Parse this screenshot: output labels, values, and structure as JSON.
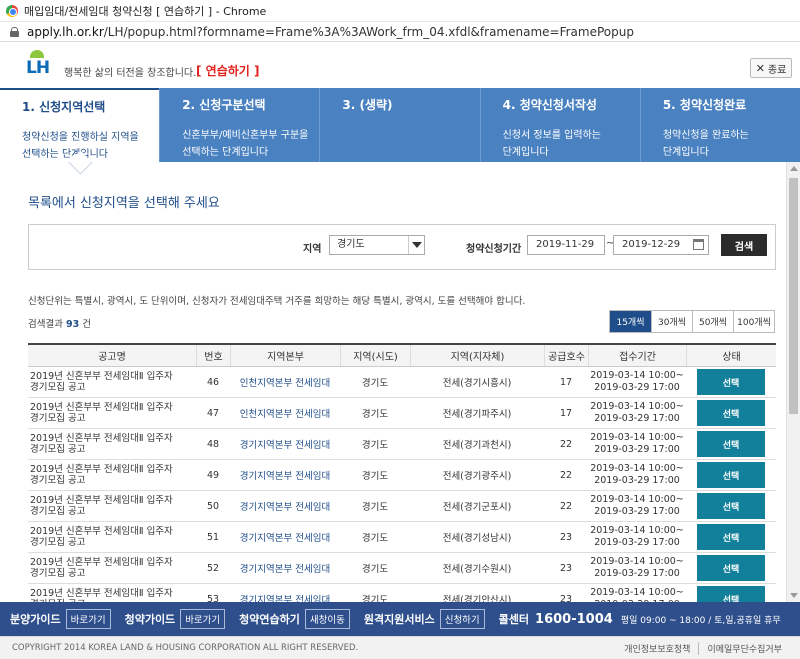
{
  "browser": {
    "title": "매입임대/전세임대 청약신청 [ 연습하기 ] - Chrome",
    "url_host": "apply.lh.or.kr",
    "url_path": "/LH/popup.html?formname=Frame%3A%3AWork_frm_04.xfdl&framename=FramePopup"
  },
  "header": {
    "logo": "LH",
    "slogan": "행복한 삶의 터전을 창조합니다.",
    "practice_tag": "[ 연습하기 ]",
    "close_label": "종료"
  },
  "steps": [
    {
      "title": "1. 신청지역선택",
      "desc1": "청약신청을 진행하실 지역을",
      "desc2": "선택하는 단계입니다"
    },
    {
      "title": "2. 신청구분선택",
      "desc1": "신혼부부/예비신혼부부 구분을",
      "desc2": "선택하는 단계입니다"
    },
    {
      "title": "3. (생략)",
      "desc1": "",
      "desc2": ""
    },
    {
      "title": "4. 청약신청서작성",
      "desc1": "신청서 정보를 입력하는",
      "desc2": "단계입니다"
    },
    {
      "title": "5. 청약신청완료",
      "desc1": "청약신청을 완료하는",
      "desc2": "단계입니다"
    }
  ],
  "main": {
    "title": "목록에서 신청지역을 선택해 주세요",
    "search": {
      "region_label": "지역",
      "region_value": "경기도",
      "period_label": "청약신청기간",
      "date_from": "2019-11-29",
      "tilde": "~",
      "date_to": "2019-12-29",
      "search_label": "검색"
    },
    "notice": "신청단위는 특별시, 광역시, 도 단위이며, 신청자가 전세임대주택 거주를 희망하는 해당 특별시, 광역시, 도를 선택해야 합니다.",
    "result_prefix": "검색결과",
    "result_count": "93",
    "result_suffix": "건",
    "page_sizes": [
      "15개씩",
      "30개씩",
      "50개씩",
      "100개씩"
    ]
  },
  "table": {
    "headers": [
      "공고명",
      "번호",
      "지역본부",
      "지역(시도)",
      "지역(지자체)",
      "공급호수",
      "접수기간",
      "상태"
    ],
    "button_label": "선택",
    "rows": [
      {
        "name1": "2019년 신혼부부 전세임대Ⅱ 입주자",
        "name2": "경기모집 공고",
        "no": "46",
        "hq": "인천지역본부 전세임대",
        "sido": "경기도",
        "local": "전세(경기시흥시)",
        "supply": "17",
        "from": "2019-03-14 10:00~",
        "to": "2019-03-29 17:00"
      },
      {
        "name1": "2019년 신혼부부 전세임대Ⅱ 입주자",
        "name2": "경기모집 공고",
        "no": "47",
        "hq": "인천지역본부 전세임대",
        "sido": "경기도",
        "local": "전세(경기파주시)",
        "supply": "17",
        "from": "2019-03-14 10:00~",
        "to": "2019-03-29 17:00"
      },
      {
        "name1": "2019년 신혼부부 전세임대Ⅱ 입주자",
        "name2": "경기모집 공고",
        "no": "48",
        "hq": "경기지역본부 전세임대",
        "sido": "경기도",
        "local": "전세(경기과천시)",
        "supply": "22",
        "from": "2019-03-14 10:00~",
        "to": "2019-03-29 17:00"
      },
      {
        "name1": "2019년 신혼부부 전세임대Ⅱ 입주자",
        "name2": "경기모집 공고",
        "no": "49",
        "hq": "경기지역본부 전세임대",
        "sido": "경기도",
        "local": "전세(경기광주시)",
        "supply": "22",
        "from": "2019-03-14 10:00~",
        "to": "2019-03-29 17:00"
      },
      {
        "name1": "2019년 신혼부부 전세임대Ⅱ 입주자",
        "name2": "경기모집 공고",
        "no": "50",
        "hq": "경기지역본부 전세임대",
        "sido": "경기도",
        "local": "전세(경기군포시)",
        "supply": "22",
        "from": "2019-03-14 10:00~",
        "to": "2019-03-29 17:00"
      },
      {
        "name1": "2019년 신혼부부 전세임대Ⅱ 입주자",
        "name2": "경기모집 공고",
        "no": "51",
        "hq": "경기지역본부 전세임대",
        "sido": "경기도",
        "local": "전세(경기성남시)",
        "supply": "23",
        "from": "2019-03-14 10:00~",
        "to": "2019-03-29 17:00"
      },
      {
        "name1": "2019년 신혼부부 전세임대Ⅱ 입주자",
        "name2": "경기모집 공고",
        "no": "52",
        "hq": "경기지역본부 전세임대",
        "sido": "경기도",
        "local": "전세(경기수원시)",
        "supply": "23",
        "from": "2019-03-14 10:00~",
        "to": "2019-03-29 17:00"
      },
      {
        "name1": "2019년 신혼부부 전세임대Ⅱ 입주자",
        "name2": "경기모집 공고",
        "no": "53",
        "hq": "경기지역본부 전세임대",
        "sido": "경기도",
        "local": "전세(경기안산시)",
        "supply": "23",
        "from": "2019-03-14 10:00~",
        "to": "2019-03-29 17:00"
      }
    ]
  },
  "footer": {
    "items": [
      {
        "label": "분양가이드",
        "button": "바로가기"
      },
      {
        "label": "청약가이드",
        "button": "바로가기"
      },
      {
        "label": "청약연습하기",
        "button": "새창이동"
      },
      {
        "label": "원격지원서비스",
        "button": "신청하기"
      }
    ],
    "call_label": "콜센터",
    "call_number": "1600-1004",
    "hours": "평일 09:00 ~ 18:00 / 토,일,공휴일 휴무",
    "copyright": "COPYRIGHT 2014 KOREA LAND & HOUSING CORPORATION ALL RIGHT RESERVED.",
    "links": [
      "개인정보보호정책",
      "이메일무단수집거부"
    ]
  }
}
